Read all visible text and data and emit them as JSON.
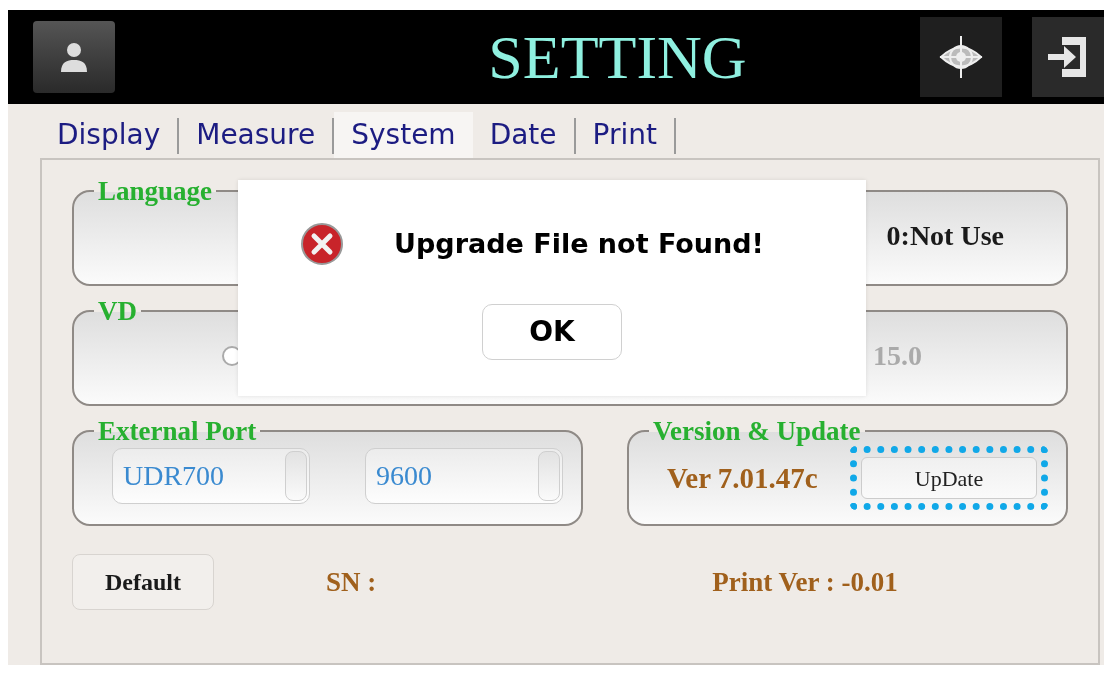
{
  "header": {
    "title": "SETTING"
  },
  "tabs": [
    {
      "label": "Display",
      "selected": false
    },
    {
      "label": "Measure",
      "selected": false
    },
    {
      "label": "System",
      "selected": true
    },
    {
      "label": "Date",
      "selected": false
    },
    {
      "label": "Print",
      "selected": false
    }
  ],
  "language": {
    "label": "Language",
    "value": "0:Not Use"
  },
  "vd": {
    "label": "VD",
    "radio": {
      "selected": false
    },
    "value": "15.0",
    "disabled": true
  },
  "external_port": {
    "label": "External Port",
    "dropdowns": [
      "UDR700",
      "9600"
    ]
  },
  "version": {
    "label": "Version & Update",
    "version": "Ver 7.01.47c",
    "button": {
      "label": "UpDate",
      "highlighted": true
    }
  },
  "footer": {
    "default_button": "Default",
    "sn": "SN :",
    "print_ver": "Print Ver : -0.01"
  },
  "dialog": {
    "message": "Upgrade File not Found!",
    "button": "OK"
  }
}
